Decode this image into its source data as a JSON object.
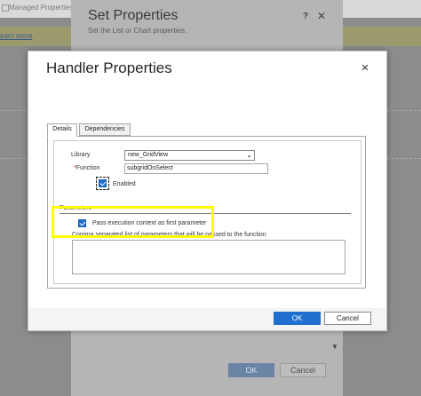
{
  "background": {
    "tab_title": "Managed Properties",
    "notice_link": "earn more"
  },
  "set_properties": {
    "title": "Set Properties",
    "subtitle": "Set the List or Chart properties.",
    "help_label": "?",
    "close_label": "✕",
    "ok_label": "OK",
    "cancel_label": "Cancel"
  },
  "handler_dialog": {
    "title": "Handler Properties",
    "close_label": "✕",
    "tabs": [
      {
        "label": "Details",
        "active": true
      },
      {
        "label": "Dependencies",
        "active": false
      }
    ],
    "library": {
      "label": "Library",
      "value": "new_GridView"
    },
    "function": {
      "required_marker": "*",
      "label": "Function",
      "value": "subgridOnSelect"
    },
    "enabled": {
      "label": "Enabled",
      "checked": true
    },
    "parameters": {
      "section_label": "Parameters",
      "pass_context_label": "Pass execution context as first parameter",
      "pass_context_checked": true,
      "list_label": "Comma separated list of parameters that will be passed to the function",
      "list_value": ""
    },
    "ok_label": "OK",
    "cancel_label": "Cancel"
  },
  "colors": {
    "primary_button": "#1f6fce",
    "highlight": "#ffff00",
    "required": "#cc0000"
  }
}
